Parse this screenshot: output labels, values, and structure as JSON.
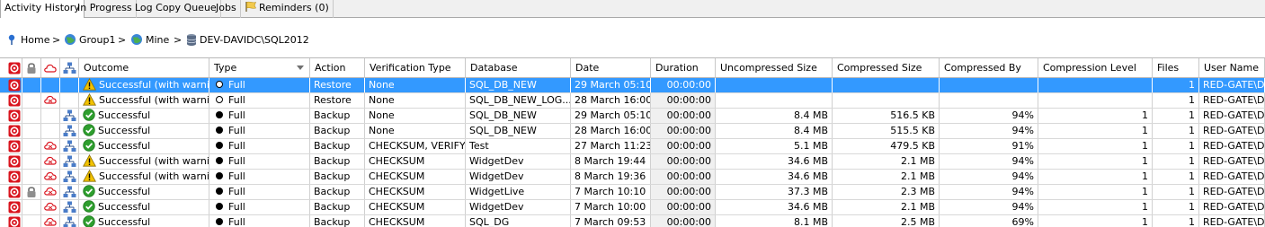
{
  "tabs": [
    {
      "label": "Activity History",
      "active": true
    },
    {
      "label": "In Progress"
    },
    {
      "label": "Log Copy Queue"
    },
    {
      "label": "Jobs"
    },
    {
      "label": "Reminders (0)",
      "icon": "flag-icon"
    }
  ],
  "breadcrumb": {
    "home": "Home",
    "group": "Group1",
    "mine": "Mine",
    "server": "DEV-DAVIDC\\SQL2012",
    "separator": ">"
  },
  "columns": {
    "outcome": "Outcome",
    "type": "Type",
    "action": "Action",
    "verification": "Verification Type",
    "database": "Database",
    "date": "Date",
    "duration": "Duration",
    "uncompressed": "Uncompressed Size",
    "compressed": "Compressed Size",
    "compressed_by": "Compressed By",
    "compression_level": "Compression Level",
    "files": "Files",
    "user": "User Name"
  },
  "rows": [
    {
      "lock": false,
      "cloud": false,
      "network": false,
      "outcome_icon": "warning-icon",
      "outcome": "Successful (with warni...",
      "type_icon": "empty",
      "type": "Full",
      "action": "Restore",
      "verification": "None",
      "database": "SQL_DB_NEW",
      "date": "29 March 05:10",
      "duration": "00:00:00",
      "uncompressed": "",
      "compressed": "",
      "compressed_by": "",
      "compression_level": "",
      "files": "1",
      "user": "RED-GATE\\Da",
      "selected": true
    },
    {
      "lock": false,
      "cloud": true,
      "network": false,
      "outcome_icon": "warning-icon",
      "outcome": "Successful (with warni...",
      "type_icon": "empty",
      "type": "Full",
      "action": "Restore",
      "verification": "None",
      "database": "SQL_DB_NEW_LOG...",
      "date": "28 March 16:00",
      "duration": "00:00:00",
      "uncompressed": "",
      "compressed": "",
      "compressed_by": "",
      "compression_level": "",
      "files": "1",
      "user": "RED-GATE\\Da"
    },
    {
      "lock": false,
      "cloud": false,
      "network": true,
      "outcome_icon": "check-icon",
      "outcome": "Successful",
      "type_icon": "full",
      "type": "Full",
      "action": "Backup",
      "verification": "None",
      "database": "SQL_DB_NEW",
      "date": "29 March 05:10",
      "duration": "00:00:00",
      "uncompressed": "8.4 MB",
      "compressed": "516.5 KB",
      "compressed_by": "94%",
      "compression_level": "1",
      "files": "1",
      "user": "RED-GATE\\Da"
    },
    {
      "lock": false,
      "cloud": false,
      "network": true,
      "outcome_icon": "check-icon",
      "outcome": "Successful",
      "type_icon": "full",
      "type": "Full",
      "action": "Backup",
      "verification": "None",
      "database": "SQL_DB_NEW",
      "date": "28 March 16:00",
      "duration": "00:00:00",
      "uncompressed": "8.4 MB",
      "compressed": "515.5 KB",
      "compressed_by": "94%",
      "compression_level": "1",
      "files": "1",
      "user": "RED-GATE\\Da"
    },
    {
      "lock": false,
      "cloud": true,
      "network": true,
      "outcome_icon": "check-icon",
      "outcome": "Successful",
      "type_icon": "full",
      "type": "Full",
      "action": "Backup",
      "verification": "CHECKSUM, VERIFY",
      "database": "Test",
      "date": "27 March 11:23",
      "duration": "00:00:00",
      "uncompressed": "5.1 MB",
      "compressed": "479.5 KB",
      "compressed_by": "91%",
      "compression_level": "1",
      "files": "1",
      "user": "RED-GATE\\Da"
    },
    {
      "lock": false,
      "cloud": true,
      "network": true,
      "outcome_icon": "warning-icon",
      "outcome": "Successful (with warni...",
      "type_icon": "full",
      "type": "Full",
      "action": "Backup",
      "verification": "CHECKSUM",
      "database": "WidgetDev",
      "date": "8 March 19:44",
      "duration": "00:00:00",
      "uncompressed": "34.6 MB",
      "compressed": "2.1 MB",
      "compressed_by": "94%",
      "compression_level": "1",
      "files": "1",
      "user": "RED-GATE\\Da"
    },
    {
      "lock": false,
      "cloud": true,
      "network": true,
      "outcome_icon": "warning-icon",
      "outcome": "Successful (with warni...",
      "type_icon": "full",
      "type": "Full",
      "action": "Backup",
      "verification": "CHECKSUM",
      "database": "WidgetDev",
      "date": "8 March 19:36",
      "duration": "00:00:00",
      "uncompressed": "34.6 MB",
      "compressed": "2.1 MB",
      "compressed_by": "94%",
      "compression_level": "1",
      "files": "1",
      "user": "RED-GATE\\Da"
    },
    {
      "lock": true,
      "cloud": true,
      "network": true,
      "outcome_icon": "check-icon",
      "outcome": "Successful",
      "type_icon": "full",
      "type": "Full",
      "action": "Backup",
      "verification": "CHECKSUM",
      "database": "WidgetLive",
      "date": "7 March 10:10",
      "duration": "00:00:00",
      "uncompressed": "37.3 MB",
      "compressed": "2.3 MB",
      "compressed_by": "94%",
      "compression_level": "1",
      "files": "1",
      "user": "RED-GATE\\Da"
    },
    {
      "lock": false,
      "cloud": true,
      "network": true,
      "outcome_icon": "check-icon",
      "outcome": "Successful",
      "type_icon": "full",
      "type": "Full",
      "action": "Backup",
      "verification": "CHECKSUM",
      "database": "WidgetDev",
      "date": "7 March 10:00",
      "duration": "00:00:00",
      "uncompressed": "34.6 MB",
      "compressed": "2.1 MB",
      "compressed_by": "94%",
      "compression_level": "1",
      "files": "1",
      "user": "RED-GATE\\Da"
    },
    {
      "lock": false,
      "cloud": true,
      "network": true,
      "outcome_icon": "check-icon",
      "outcome": "Successful",
      "type_icon": "full",
      "type": "Full",
      "action": "Backup",
      "verification": "CHECKSUM",
      "database": "SQL_DG",
      "date": "7 March 09:53",
      "duration": "00:00:00",
      "uncompressed": "8.1 MB",
      "compressed": "2.5 MB",
      "compressed_by": "69%",
      "compression_level": "1",
      "files": "1",
      "user": "RED-GATE\\Da"
    }
  ],
  "colors": {
    "selection": "#3399ff",
    "status_red": "#d9141e",
    "check_green": "#2e9e2e",
    "warning_yellow": "#f2c200"
  }
}
